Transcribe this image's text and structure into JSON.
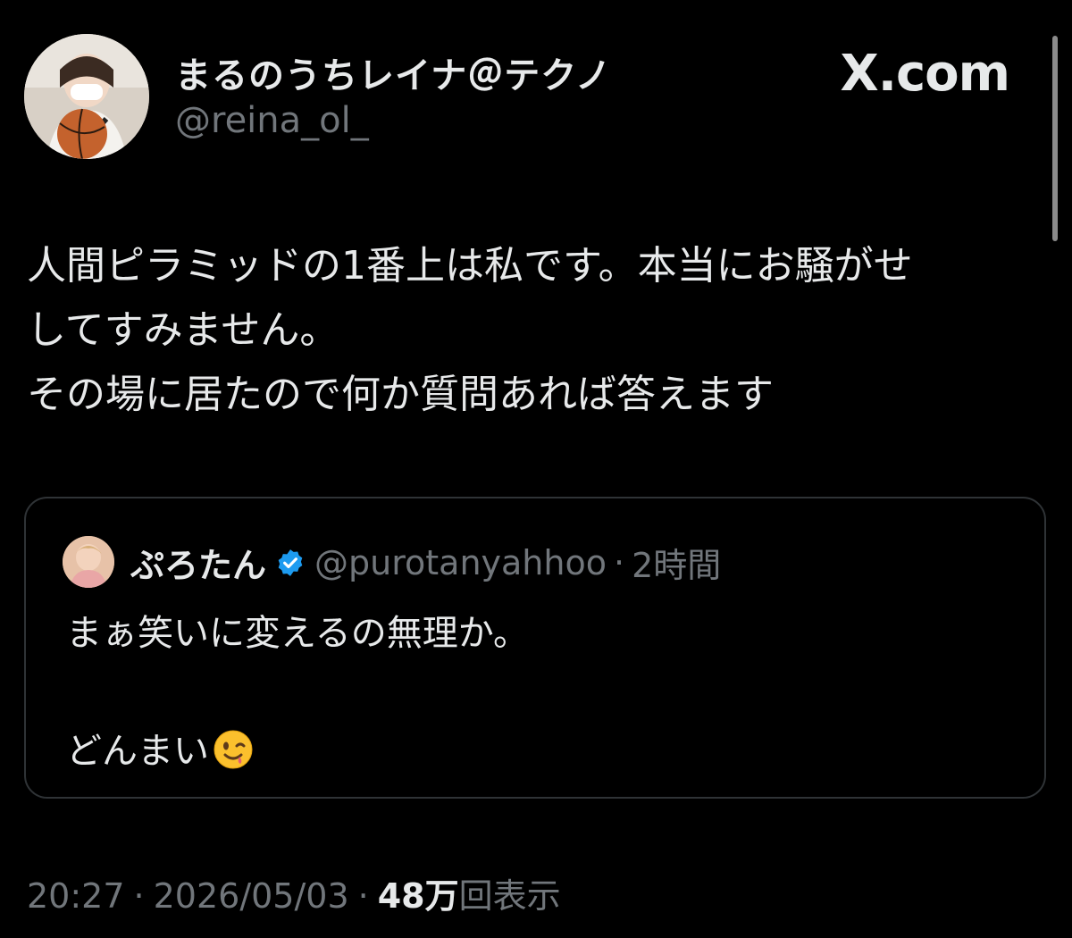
{
  "author": {
    "display_name": "まるのうちレイナ＠テクノ",
    "handle": "@reina_ol_"
  },
  "brand": "X.com",
  "tweet": {
    "lines": [
      "人間ピラミッドの1番上は私です。本当にお騒がせ",
      "してすみません。",
      "その場に居たので何か質問あれば答えます"
    ]
  },
  "quote": {
    "display_name": "ぷろたん",
    "handle": "@purotanyahhoo",
    "separator": "·",
    "time": "2時間",
    "line1": "まぁ笑いに変えるの無理か。",
    "line2": "どんまい",
    "emoji": "winking-face"
  },
  "meta": {
    "time": "20:27",
    "separator": "·",
    "date": "2026/05/03",
    "views_count": "48万",
    "views_label": "回表示"
  },
  "colors": {
    "background": "#000000",
    "text": "#e7e9ea",
    "secondary": "#71767b",
    "border": "#2f3336",
    "verified": "#1d9bf0"
  }
}
